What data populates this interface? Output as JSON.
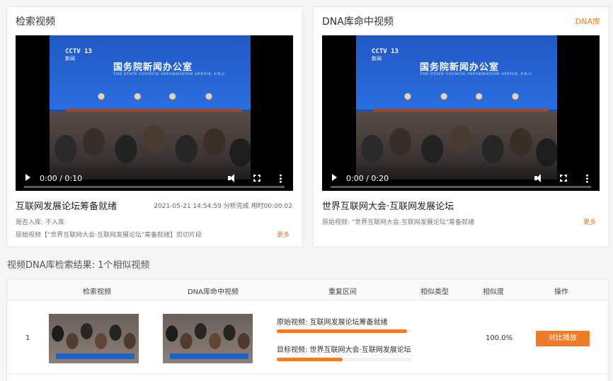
{
  "left_card": {
    "title": "检索视频",
    "video": {
      "time": "0:00 / 0:10",
      "channel_logo": "CCTV 13",
      "channel_logo_sub": "新闻",
      "brand": "国务院新闻办公室",
      "brand_sub": "THE STATE COUNCIL INFORMATION OFFICE, P.R.C",
      "progress": 0
    },
    "video_title": "互联网发展论坛筹备就绪",
    "status_line": "2021-05-21 14:54:59 分析完成 用时00:00:02",
    "in_library": "是否入库: 不入库",
    "original": "原始视频【\"世界互联网大会·互联网发展论坛\"筹备就绪】剪切片段",
    "more": "更多"
  },
  "right_card": {
    "title": "DNA库命中视频",
    "link": "DNA库",
    "video": {
      "time": "0:00 / 0:20",
      "channel_logo": "CCTV 13",
      "channel_logo_sub": "新闻",
      "brand": "国务院新闻办公室",
      "brand_sub": "THE STATE COUNCIL INFORMATION OFFICE, P.R.C",
      "progress": 0
    },
    "video_title": "世界互联网大会·互联网发展论坛",
    "original": "原始视频: \"世界互联网大会·互联网发展论坛\"筹备就绪",
    "more": "更多"
  },
  "results_title": "视频DNA库检索结果: 1个相似视频",
  "table": {
    "headers": [
      "检索视频",
      "DNA库命中视频",
      "重复区间",
      "相似类型",
      "相似度",
      "操作"
    ],
    "rows": [
      {
        "index": "1",
        "source_label": "原始视频: 互联网发展论坛筹备就绪",
        "source_fill": 0.97,
        "target_label": "目标视频: 世界互联网大会·互联网发展论坛",
        "target_fill": 0.49,
        "similar_type": "",
        "similarity": "100.0%",
        "action": "对比播放"
      }
    ]
  },
  "colors": {
    "accent": "#f07a26",
    "video_blue": "#1f58c4"
  }
}
